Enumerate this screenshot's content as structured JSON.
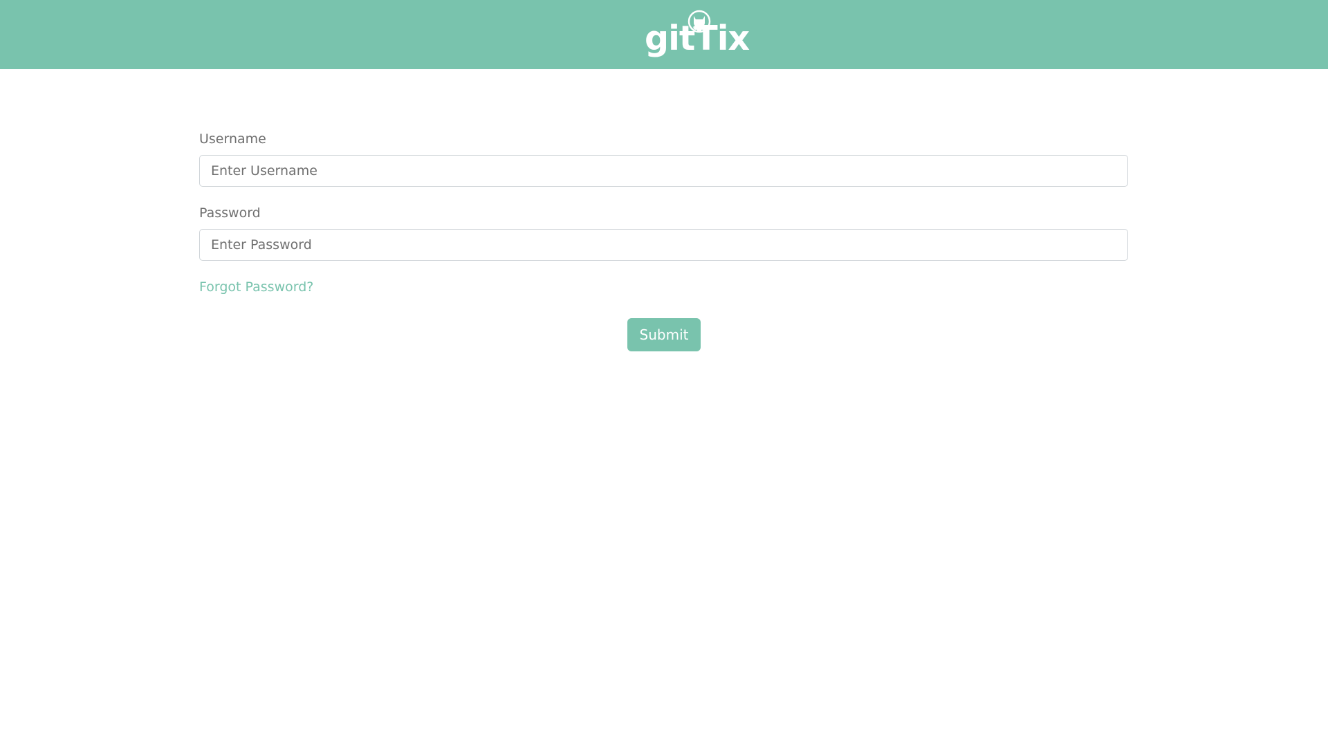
{
  "header": {
    "logo_text": "gitTix",
    "logo_icon": "octocat-icon",
    "background_color": "#79c3ad"
  },
  "login_form": {
    "username": {
      "label": "Username",
      "placeholder": "Enter Username",
      "value": ""
    },
    "password": {
      "label": "Password",
      "placeholder": "Enter Password",
      "value": ""
    },
    "forgot_password_label": "Forgot Password?",
    "submit_label": "Submit"
  },
  "colors": {
    "accent": "#79c3ad",
    "label_text": "#6f6f6f",
    "input_border": "#cfd4d8"
  }
}
